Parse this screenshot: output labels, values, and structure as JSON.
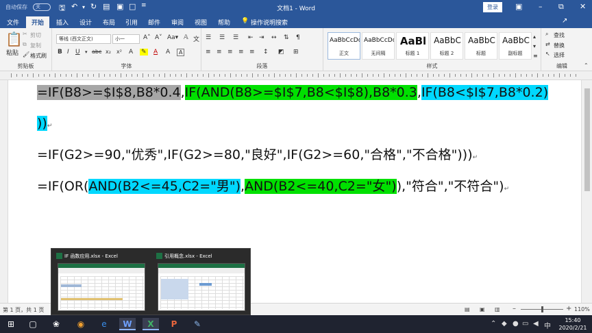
{
  "titlebar": {
    "autosave_label": "自动保存",
    "autosave_state": "关",
    "doc_title": "文档1 - Word",
    "login_label": "登录"
  },
  "tabs": [
    {
      "label": "文件"
    },
    {
      "label": "开始"
    },
    {
      "label": "插入"
    },
    {
      "label": "设计"
    },
    {
      "label": "布局"
    },
    {
      "label": "引用"
    },
    {
      "label": "邮件"
    },
    {
      "label": "审阅"
    },
    {
      "label": "视图"
    },
    {
      "label": "帮助"
    }
  ],
  "tell_me": "操作说明搜索",
  "ribbon": {
    "clipboard": {
      "paste": "粘贴",
      "cut": "剪切",
      "copy": "复制",
      "format_painter": "格式刷",
      "label": "剪贴板"
    },
    "font": {
      "font_name": "等线 (西文正文)",
      "font_size": "小一",
      "label": "字体"
    },
    "paragraph": {
      "label": "段落"
    },
    "styles": {
      "label": "样式",
      "items": [
        {
          "preview": "AaBbCcDc",
          "name": "正文"
        },
        {
          "preview": "AaBbCcDc",
          "name": "无间隔"
        },
        {
          "preview": "AaBl",
          "name": "标题 1"
        },
        {
          "preview": "AaBbC",
          "name": "标题 2"
        },
        {
          "preview": "AaBbC",
          "name": "标题"
        },
        {
          "preview": "AaBbC",
          "name": "副标题"
        }
      ]
    },
    "editing": {
      "find": "查找",
      "replace": "替换",
      "select": "选择",
      "label": "编辑"
    }
  },
  "document": {
    "line1": {
      "seg_gray": "=IF(B8>=$I$8,B8*0.4",
      "comma1": ",",
      "seg_green": "IF(AND(B8>=$I$7,B8<$I$8),B8*0.3",
      "comma2": ",",
      "seg_cyan": "IF(B8<$I$7,B8*0.2)"
    },
    "line2": {
      "seg_cyan": "))"
    },
    "line3": {
      "text": "=IF(G2>=90,\"优秀\",IF(G2>=80,\"良好\",IF(G2>=60,\"合格\",\"不合格\")))"
    },
    "line4": {
      "prefix": "=IF(OR(",
      "seg_cyan": "AND(B2<=45,C2=\"男\")",
      "comma": ",",
      "seg_green": "AND(B2<=40,C2=\"女\")",
      "suffix": "),\"符合\",\"不符合\")"
    }
  },
  "statusbar": {
    "page_info": "第 1 页，共 1 页",
    "zoom": "110%"
  },
  "taskbar_popup": {
    "windows": [
      {
        "title": "IF 函数应用.xlsx - Excel"
      },
      {
        "title": "引用概念.xlsx - Excel"
      }
    ]
  },
  "taskbar": {
    "ime": "中",
    "time": "15:40",
    "date": "2020/2/21"
  },
  "colors": {
    "word_blue": "#2b579a",
    "highlight_gray": "#a6a6a6",
    "highlight_green": "#00e000",
    "highlight_cyan": "#00d8ff",
    "excel_green": "#1d7044"
  }
}
